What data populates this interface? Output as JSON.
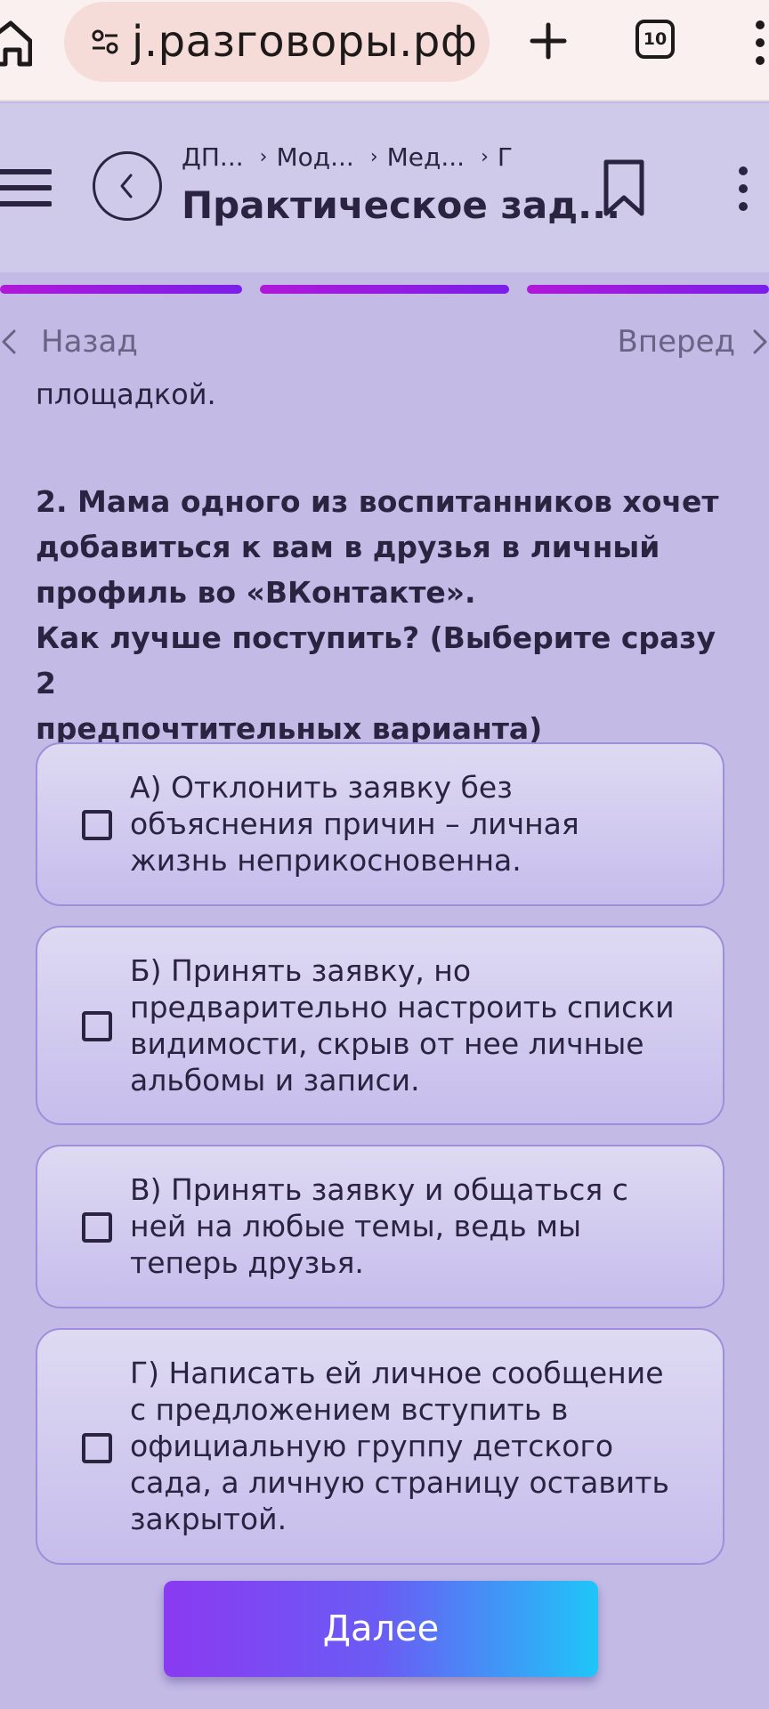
{
  "browser": {
    "url": "ј.разговоры.рф",
    "tab_count": "10"
  },
  "header": {
    "breadcrumbs": [
      "ДП...",
      "Мод...",
      "Мед...",
      "Г"
    ],
    "title": "Практическое зад..."
  },
  "nav": {
    "back_label": "Назад",
    "next_label": "Вперед"
  },
  "content": {
    "intro": "площадкой.",
    "question_line1": "2.  Мама одного из воспитанников хочет",
    "question_line2": "добавиться к вам в друзья в личный",
    "question_line3": "профиль во «ВКонтакте».",
    "question_line4": "Как лучше поступить? (Выберите сразу 2",
    "question_line5": "предпочтительных варианта)",
    "options": [
      {
        "lines": [
          "А) Отклонить заявку без",
          "объяснения причин – личная",
          "жизнь неприкосновенна."
        ],
        "checked": false
      },
      {
        "lines": [
          "Б) Принять заявку, но",
          "предварительно настроить списки",
          "видимости, скрыв от нее личные",
          "альбомы и записи."
        ],
        "checked": false
      },
      {
        "lines": [
          "В) Принять заявку и общаться с",
          "ней на любые темы, ведь мы",
          "теперь друзья."
        ],
        "checked": false
      },
      {
        "lines": [
          "Г) Написать ей личное сообщение",
          "с предложением вступить в",
          "официальную группу детского",
          "сада, а личную страницу оставить",
          "закрытой."
        ],
        "checked": false
      }
    ],
    "submit_label": "Далее"
  },
  "colors": {
    "background": "#c3bae6",
    "header_bg": "#cfcaea",
    "progress": "#9a1ee0",
    "option_border": "#9d8fd9",
    "button_gradient_start": "#8a3af2",
    "button_gradient_end": "#1ec6f8"
  }
}
